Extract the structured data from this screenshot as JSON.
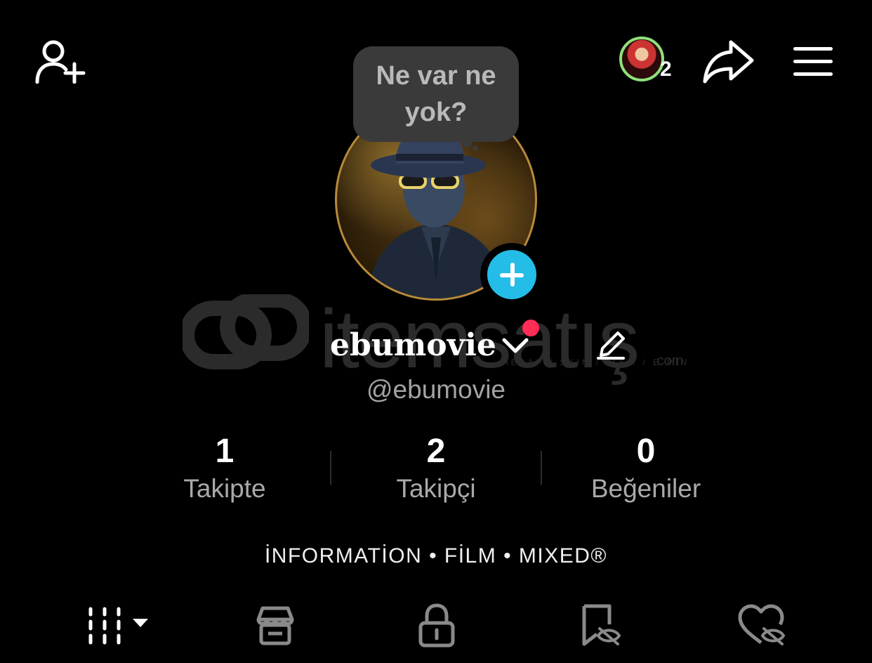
{
  "header": {
    "add_user_icon": "add-user-icon",
    "friends_avatar_count": "2",
    "share_icon": "share-arrow-icon",
    "menu_icon": "hamburger-menu-icon"
  },
  "status_bubble": {
    "text": "Ne var ne yok?"
  },
  "profile": {
    "display_name": "ebumovie",
    "handle": "@ebumovie",
    "add_story_icon": "plus-icon",
    "edit_icon": "pencil-icon",
    "switch_account_icon": "chevron-down-icon",
    "notification_dot_color": "#ff2c55",
    "add_story_color": "#24bde8"
  },
  "stats": [
    {
      "value": "1",
      "label": "Takipte"
    },
    {
      "value": "2",
      "label": "Takipçi"
    },
    {
      "value": "0",
      "label": "Beğeniler"
    }
  ],
  "bio": "İNFORMATİON • FİLM • MIXED®",
  "watermark": {
    "brand": "itemsatış",
    "subline": "HESAP / SKIN / ITEM / E-PIN",
    "suffix": ".com"
  },
  "tabs": [
    {
      "icon": "grid-icon",
      "has_dropdown": true
    },
    {
      "icon": "shop-icon"
    },
    {
      "icon": "lock-icon"
    },
    {
      "icon": "bookmark-eye-off-icon"
    },
    {
      "icon": "heart-eye-off-icon"
    }
  ]
}
